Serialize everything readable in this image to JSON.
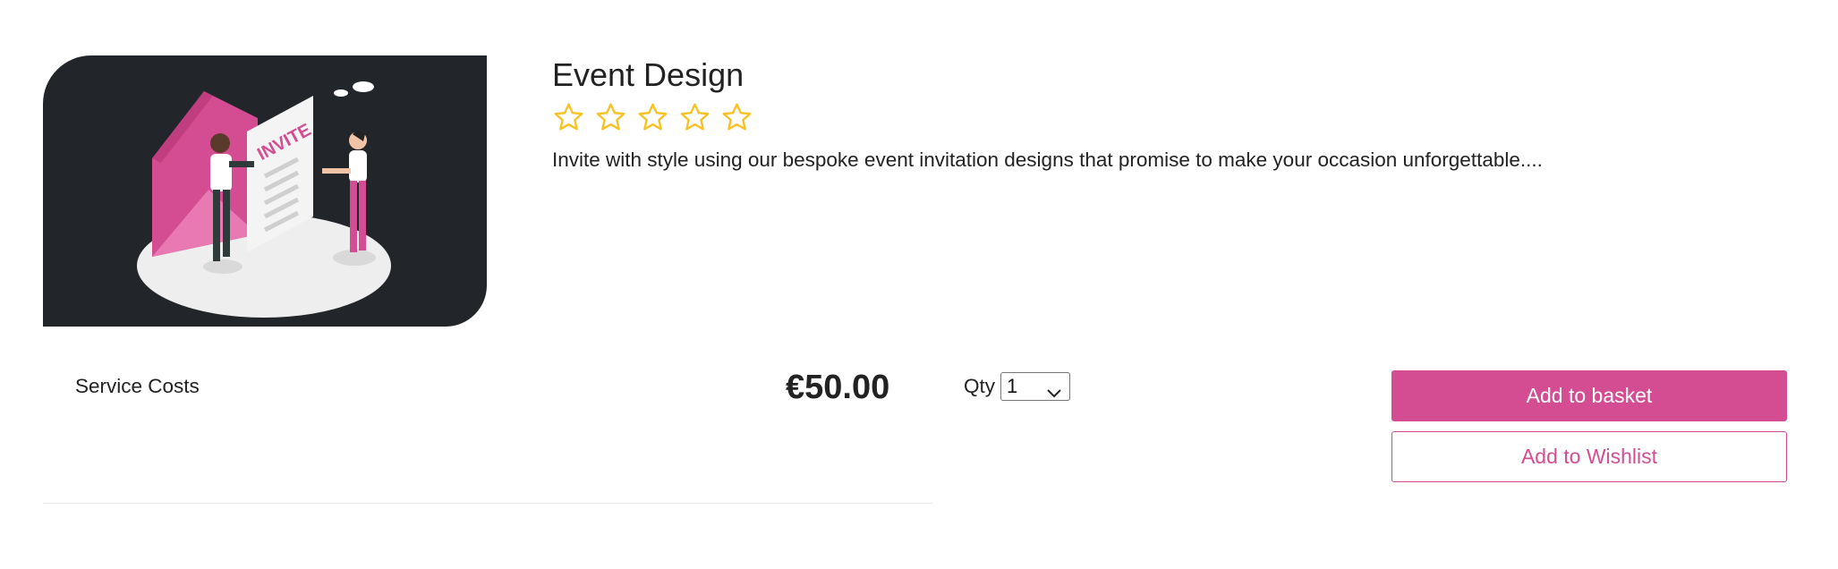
{
  "product": {
    "title": "Event Design",
    "rating": {
      "value": 0,
      "max": 5
    },
    "description": "Invite with style using our bespoke event invitation designs that promise to make your occasion unforgettable....",
    "image": {
      "illustration_text": "INVITE"
    }
  },
  "pricing": {
    "cost_label": "Service Costs",
    "price": "€50.00"
  },
  "quantity": {
    "label": "Qty",
    "selected": "1"
  },
  "actions": {
    "add_to_basket": "Add to basket",
    "add_to_wishlist": "Add to Wishlist"
  },
  "colors": {
    "accent": "#d44d93",
    "star": "#f7c224",
    "image_background": "#222529",
    "text": "#222222"
  }
}
